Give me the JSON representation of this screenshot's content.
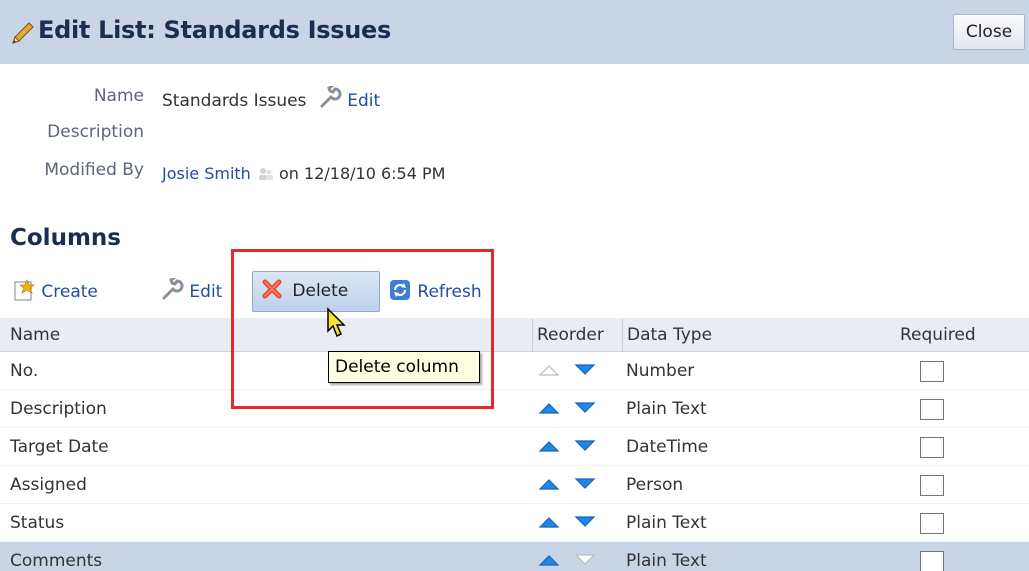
{
  "header": {
    "title": "Edit List: Standards Issues",
    "close_label": "Close"
  },
  "properties": {
    "name_label": "Name",
    "name_value": "Standards Issues",
    "edit_link": "Edit",
    "description_label": "Description",
    "modified_by_label": "Modified By",
    "modified_by_user": "Josie Smith",
    "modified_on": "on 12/18/10 6:54 PM"
  },
  "columns_section": {
    "title": "Columns"
  },
  "toolbar": {
    "create_label": "Create",
    "edit_label": "Edit",
    "delete_label": "Delete",
    "refresh_label": "Refresh"
  },
  "tooltip": {
    "text": "Delete column"
  },
  "table": {
    "headers": [
      "Name",
      "Reorder",
      "Data Type",
      "Required"
    ],
    "rows": [
      {
        "name": "No.",
        "data_type": "Number",
        "required": false
      },
      {
        "name": "Description",
        "data_type": "Plain Text",
        "required": false
      },
      {
        "name": "Target Date",
        "data_type": "DateTime",
        "required": false
      },
      {
        "name": "Assigned",
        "data_type": "Person",
        "required": false
      },
      {
        "name": "Status",
        "data_type": "Plain Text",
        "required": false
      },
      {
        "name": "Comments",
        "data_type": "Plain Text",
        "required": false
      }
    ]
  },
  "colors": {
    "header_bg": "#c9d4e6",
    "link": "#1f4ea8",
    "highlight": "#e5282c",
    "arrow_active": "#1e88e5",
    "arrow_disabled": "#b8bcc2"
  },
  "icons": [
    "pencil-icon",
    "wrench-icon",
    "presence-icon",
    "create-icon",
    "delete-x-icon",
    "refresh-icon",
    "arrow-up-icon",
    "arrow-down-icon",
    "mouse-cursor-icon"
  ]
}
